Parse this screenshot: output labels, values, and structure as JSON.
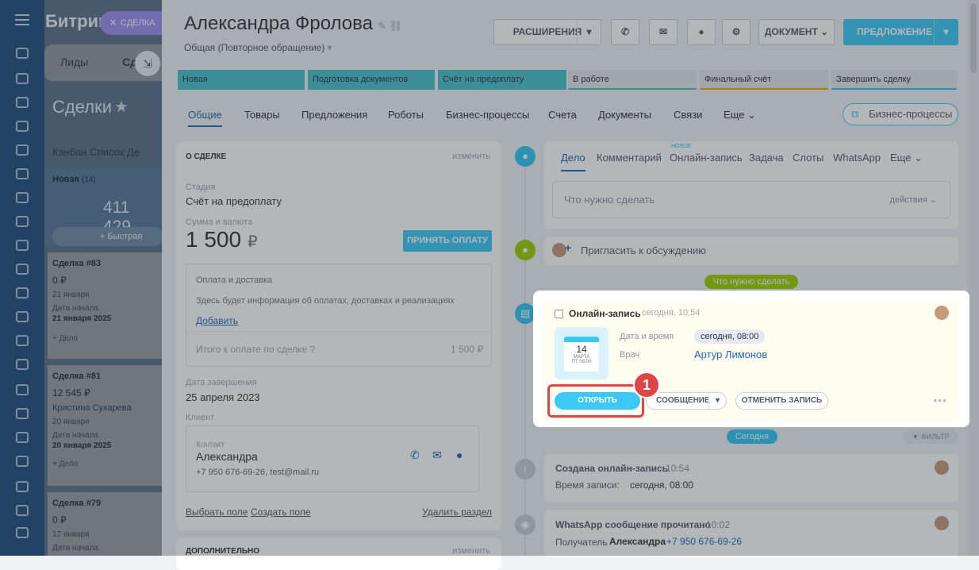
{
  "bg": {
    "logo": "Битрикс",
    "pill": "СДЕЛКА",
    "tabs": [
      "Лиды",
      "Сд"
    ],
    "title": "Сделки",
    "views": "Канбан   Список   Де",
    "column_header": "Новая",
    "column_count": "(14)",
    "column_sum": "411 429",
    "quick_deal": "+ Быстрая сделк",
    "cards": [
      {
        "title": "Сделка #83",
        "amount": "0 ₽",
        "date": "21 января",
        "start_label": "Дата начала",
        "start": "21 января 2025",
        "deal": "+ Дело"
      },
      {
        "title": "Сделка #81",
        "amount": "12 545 ₽",
        "contact": "Кристина Сухарева",
        "date": "20 января",
        "start_label": "Дата начала",
        "start": "20 января 2025",
        "deal": "+ Дело"
      },
      {
        "title": "Сделка #79",
        "amount": "0 ₽",
        "date": "17 января",
        "start_label": "Дата начала"
      }
    ]
  },
  "header": {
    "title": "Александра Фролова",
    "subtitle": "Общая (Повторное обращение)",
    "extensions": "РАСШИРЕНИЯ",
    "document": "ДОКУМЕНТ",
    "proposal": "ПРЕДЛОЖЕНИЕ"
  },
  "stages": [
    "Новая",
    "Подготовка документов",
    "Счёт на предоплату",
    "В работе",
    "Финальный счёт",
    "Завершить сделку"
  ],
  "stage_colors": {
    "active": "#48c1cd",
    "inactive": "#e3e6e9",
    "final": "#f7a700",
    "done": "#2fc6f6"
  },
  "tabs": [
    "Общие",
    "Товары",
    "Предложения",
    "Роботы",
    "Бизнес-процессы",
    "Счета",
    "Документы",
    "Связи",
    "Еще"
  ],
  "bp_button": "Бизнес-процессы",
  "about": {
    "header": "О СДЕЛКЕ",
    "edit": "изменить",
    "stage_label": "Стадия",
    "stage": "Счёт на предоплату",
    "sum_label": "Сумма и валюта",
    "sum": "1 500",
    "currency": "₽",
    "accept_payment": "ПРИНЯТЬ ОПЛАТУ",
    "payment_title": "Оплата и доставка",
    "payment_text": "Здесь будет информация об оплатах, доставках и реализациях",
    "add": "Добавить",
    "total_label": "Итого к оплате по сделке",
    "total": "1 500 ₽",
    "end_label": "Дата завершения",
    "end": "25 апреля 2023",
    "client_label": "Клиент",
    "contact_label": "Контакт",
    "contact_name": "Александра",
    "contact_info": "+7 950 676-69-26, test@mail.ru",
    "select_field": "Выбрать поле",
    "create_field": "Создать поле",
    "delete_section": "Удалить раздел",
    "extra_header": "ДОПОЛНИТЕЛЬНО",
    "extra_edit": "изменить"
  },
  "timeline": {
    "tabs": [
      "Дело",
      "Комментарий",
      "Онлайн-запись",
      "Задача",
      "Слоты",
      "WhatsApp",
      "Еще"
    ],
    "new_badge": "НОВОЕ",
    "todo_placeholder": "Что нужно сделать",
    "actions": "действия",
    "invite": "Пригласить к обсуждению",
    "todo_chip": "Что нужно сделать",
    "booking": {
      "title": "Онлайн-запись",
      "time": "сегодня, 10:54",
      "cal_day": "14",
      "cal_month": "МАРТА",
      "cal_time": "ПТ 08:00",
      "dt_label": "Дата и время",
      "dt_value": "сегодня, 08:00",
      "doctor_label": "Врач",
      "doctor": "Артур Лимонов",
      "open": "ОТКРЫТЬ",
      "message": "СООБЩЕНИЕ",
      "cancel": "ОТМЕНИТЬ ЗАПИСЬ",
      "step": "1"
    },
    "today": "Сегодня",
    "filter": "ФИЛЬТР",
    "created_title": "Создана онлайн-запись",
    "created_time": "10:54",
    "created_label": "Время записи:",
    "created_value": "сегодня, 08:00",
    "wa_title": "WhatsApp сообщение прочитано",
    "wa_time": "10:02",
    "wa_label": "Получатель",
    "wa_name": "Александра",
    "wa_phone": "+7 950 676-69-26"
  }
}
